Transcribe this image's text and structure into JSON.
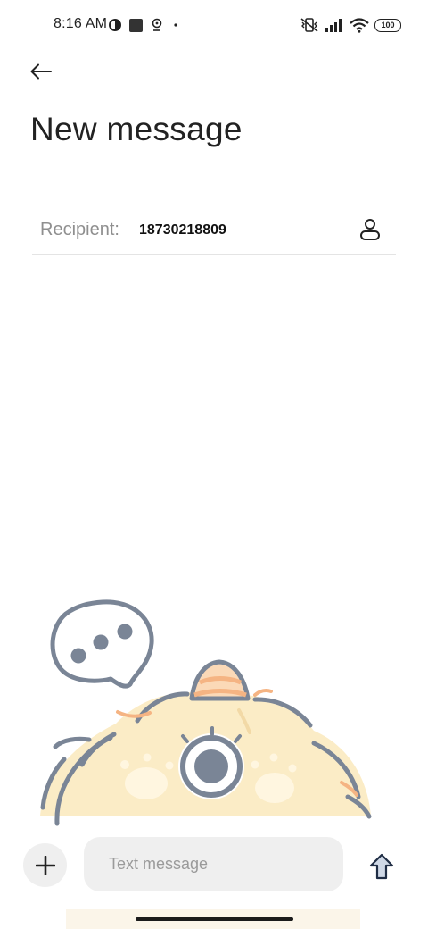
{
  "status_bar": {
    "time": "8:16 AM",
    "battery": "100",
    "icons": [
      "data-saver-icon",
      "square-notification-icon",
      "location-icon",
      "dot-icon",
      "vibrate-icon",
      "signal-icon",
      "wifi-icon",
      "battery-icon"
    ]
  },
  "header": {
    "back_icon": "arrow-left-icon",
    "title": "New message"
  },
  "recipient": {
    "label": "Recipient:",
    "value": "18730218809",
    "contact_icon": "person-icon"
  },
  "composer": {
    "attach_icon": "plus-icon",
    "placeholder": "Text message",
    "value": "",
    "send_icon": "arrow-up-icon"
  },
  "colors": {
    "background": "#ffffff",
    "input_background": "#efefef",
    "label_gray": "#8f8f8f",
    "illustration_fur": "#fbecc6",
    "illustration_outline": "#7a8596",
    "illustration_accent": "#f5b483",
    "send_icon": "#5b6f8c"
  }
}
